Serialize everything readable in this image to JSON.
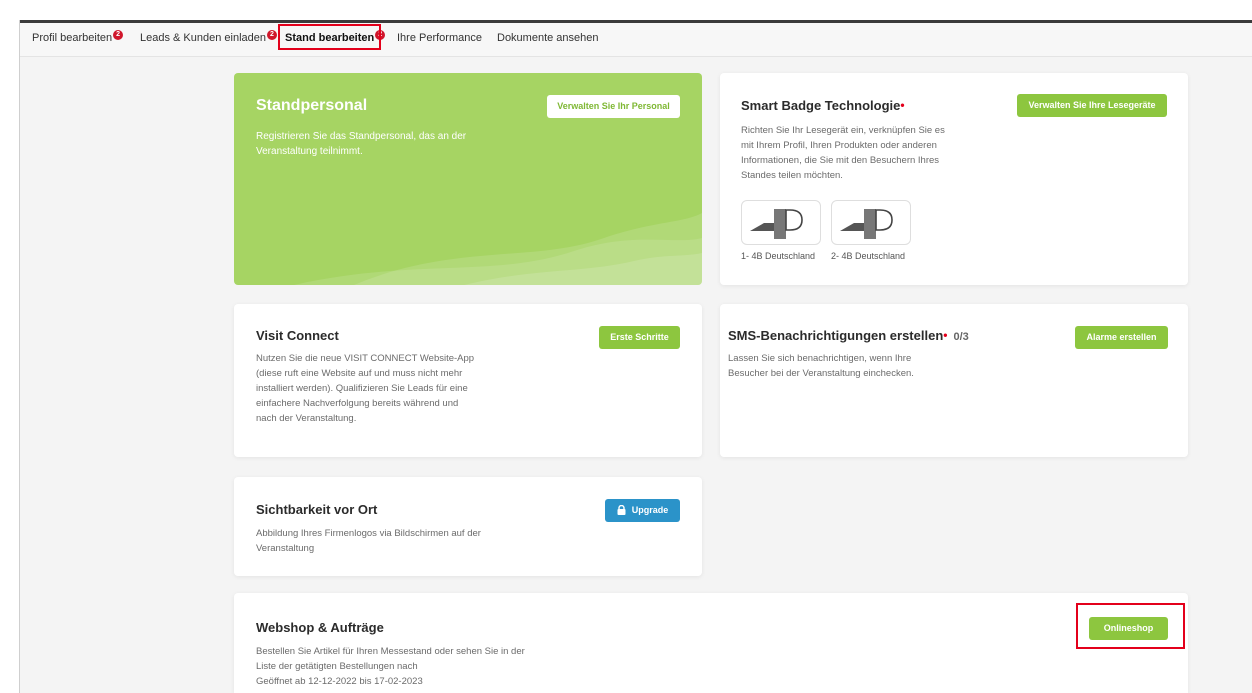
{
  "tabs": [
    {
      "label": "Profil bearbeiten",
      "badge": "2"
    },
    {
      "label": "Leads & Kunden einladen",
      "badge": "2"
    },
    {
      "label": "Stand bearbeiten",
      "badge": "2"
    },
    {
      "label": "Ihre Performance"
    },
    {
      "label": "Dokumente ansehen"
    }
  ],
  "active_tab": "Stand bearbeiten",
  "cards": {
    "standpersonal": {
      "title": "Standpersonal",
      "description": "Registrieren Sie das Standpersonal, das an der Veranstaltung teilnimmt.",
      "button": "Verwalten Sie Ihr Personal"
    },
    "smart_badge": {
      "title": "Smart Badge Technologie",
      "description": "Richten Sie Ihr Lesegerät ein, verknüpfen Sie es mit Ihrem Profil, Ihren Produkten oder anderen Informationen, die Sie mit den Besuchern Ihres Standes teilen möchten.",
      "button": "Verwalten Sie Ihre Lesegeräte",
      "readers": [
        {
          "caption": "1- 4B Deutschland",
          "logo_text": "D"
        },
        {
          "caption": "2- 4B Deutschland",
          "logo_text": "D"
        }
      ]
    },
    "visit_connect": {
      "title": "Visit Connect",
      "description": "Nutzen Sie die neue VISIT CONNECT Website-App (diese ruft eine Website auf und muss nicht mehr installiert werden). Qualifizieren Sie Leads für eine einfachere Nachverfolgung bereits während und nach der Veranstaltung.",
      "button": "Erste Schritte"
    },
    "sms": {
      "title": "SMS-Benachrichtigungen erstellen",
      "counter": "0/3",
      "description": "Lassen Sie sich benachrichtigen, wenn Ihre Besucher bei der Veranstaltung einchecken.",
      "button": "Alarme erstellen"
    },
    "sichtbarkeit": {
      "title": "Sichtbarkeit vor Ort",
      "description": "Abbildung Ihres Firmenlogos via Bildschirmen auf der Veranstaltung",
      "button": "Upgrade"
    },
    "webshop": {
      "title": "Webshop & Aufträge",
      "description": "Bestellen Sie Artikel für Ihren Messestand oder sehen Sie in der Liste der getätigten Bestellungen nach",
      "opening": "Geöffnet ab 12-12-2022 bis 17-02-2023",
      "button": "Onlineshop"
    }
  },
  "colors": {
    "accent_green": "#8dc63f",
    "card_green": "#a6d463",
    "upgrade_blue": "#2b93c9",
    "badge_red": "#d0162b",
    "highlight_red": "#e3001b"
  }
}
